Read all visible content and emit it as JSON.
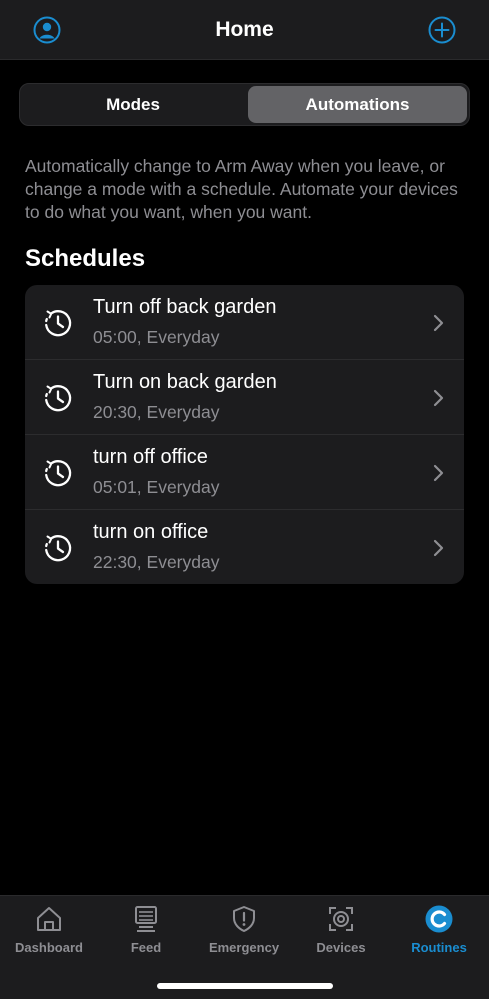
{
  "header": {
    "title": "Home",
    "left_icon": "user-circle-icon",
    "right_icon": "plus-circle-icon"
  },
  "segments": {
    "modes_label": "Modes",
    "automations_label": "Automations",
    "selected": "Automations"
  },
  "description": "Automatically change to Arm Away when you leave, or change a mode with a schedule. Automate your devices to do what you want, when you want.",
  "schedules": {
    "title": "Schedules",
    "items": [
      {
        "title": "Turn off back garden",
        "subtitle": "05:00, Everyday"
      },
      {
        "title": "Turn on back garden",
        "subtitle": "20:30, Everyday"
      },
      {
        "title": "turn off office",
        "subtitle": "05:01, Everyday"
      },
      {
        "title": "turn on office",
        "subtitle": "22:30, Everyday"
      }
    ]
  },
  "tabbar": {
    "active": "Routines",
    "items": [
      {
        "label": "Dashboard",
        "icon": "house-icon"
      },
      {
        "label": "Feed",
        "icon": "monitor-icon"
      },
      {
        "label": "Emergency",
        "icon": "shield-alert-icon"
      },
      {
        "label": "Devices",
        "icon": "camera-scan-icon"
      },
      {
        "label": "Routines",
        "icon": "routine-circle-icon"
      }
    ]
  },
  "colors": {
    "accent": "#1a8dd0",
    "background": "#000000",
    "surface": "#1c1c1e",
    "muted_text": "#8e8e93",
    "segment_selected": "#636366"
  }
}
